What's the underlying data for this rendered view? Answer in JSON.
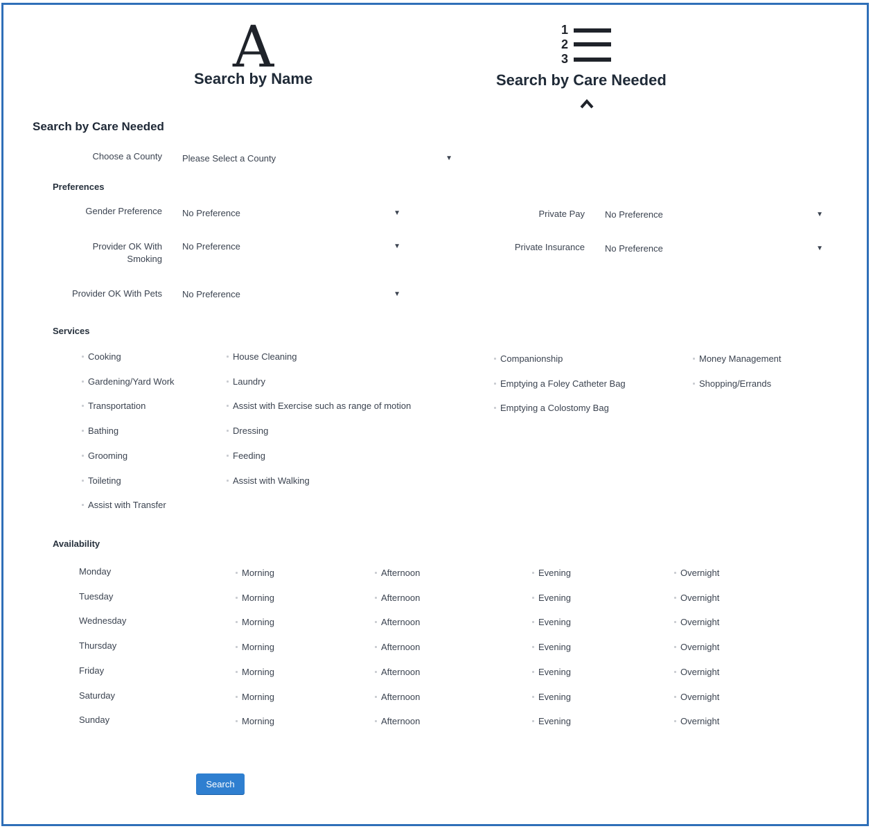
{
  "header": {
    "name_toggle": {
      "glyph": "A",
      "title": "Search by Name"
    },
    "care_toggle": {
      "numbers": [
        "1",
        "2",
        "3"
      ],
      "title": "Search by Care Needed"
    }
  },
  "form": {
    "title": "Search by Care Needed",
    "county": {
      "label": "Choose a County",
      "value": "Please Select a County"
    },
    "preferences": {
      "title": "Preferences",
      "gender": {
        "label": "Gender Preference",
        "value": "No Preference"
      },
      "smoking": {
        "label_line1": "Provider OK With",
        "label_line2": "Smoking",
        "value": "No Preference"
      },
      "pets": {
        "label": "Provider OK With Pets",
        "value": "No Preference"
      },
      "private_pay": {
        "label": "Private Pay",
        "value": "No Preference"
      },
      "private_insurance": {
        "label": "Private Insurance",
        "value": "No Preference"
      }
    },
    "services": {
      "title": "Services",
      "col1": [
        "Cooking",
        "Gardening/Yard Work",
        "Transportation",
        "Bathing",
        "Grooming",
        "Toileting",
        "Assist with Transfer"
      ],
      "col2": [
        "House Cleaning",
        "Laundry",
        "Assist with Exercise such as range of motion",
        "Dressing",
        "Feeding",
        "Assist with Walking"
      ],
      "col3": [
        "Companionship",
        "Emptying a Foley Catheter Bag",
        "Emptying a Colostomy Bag"
      ],
      "col4": [
        "Money Management",
        "Shopping/Errands"
      ]
    },
    "availability": {
      "title": "Availability",
      "days": [
        "Monday",
        "Tuesday",
        "Wednesday",
        "Thursday",
        "Friday",
        "Saturday",
        "Sunday"
      ],
      "slots": [
        "Morning",
        "Afternoon",
        "Evening",
        "Overnight"
      ]
    },
    "search_label": "Search"
  },
  "colors": {
    "frame": "#2f6fb8",
    "button": "#2f7fd0"
  }
}
